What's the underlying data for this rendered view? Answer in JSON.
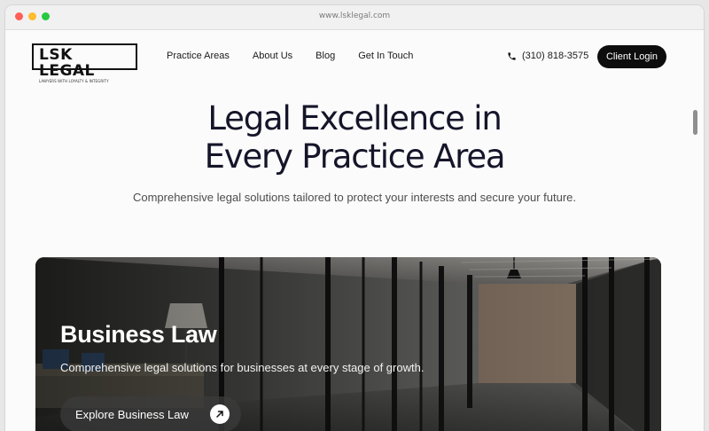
{
  "browser": {
    "url": "www.lsklegal.com"
  },
  "header": {
    "logo_name": "LSK LEGAL",
    "logo_tagline": "LAWYERS WITH LOYALTY & INTEGRITY",
    "nav": [
      {
        "label": "Practice Areas"
      },
      {
        "label": "About Us"
      },
      {
        "label": "Blog"
      },
      {
        "label": "Get In Touch"
      }
    ],
    "phone": "(310) 818-3575",
    "login_label": "Client Login",
    "icons": {
      "phone": "phone-icon"
    }
  },
  "hero": {
    "title_line1": "Legal Excellence in",
    "title_line2": "Every Practice Area",
    "subtitle": "Comprehensive legal solutions tailored to protect your interests and secure your future."
  },
  "card": {
    "title": "Business Law",
    "description": "Comprehensive legal solutions for businesses at every stage of growth.",
    "button_label": "Explore Business Law",
    "button_icon": "arrow-up-right-icon",
    "image": "office-corridor-photo"
  },
  "colors": {
    "primary_dark": "#0d0d0d",
    "heading": "#15152a",
    "body_text": "#4d4d4d",
    "page_bg": "#fbfbfb"
  }
}
